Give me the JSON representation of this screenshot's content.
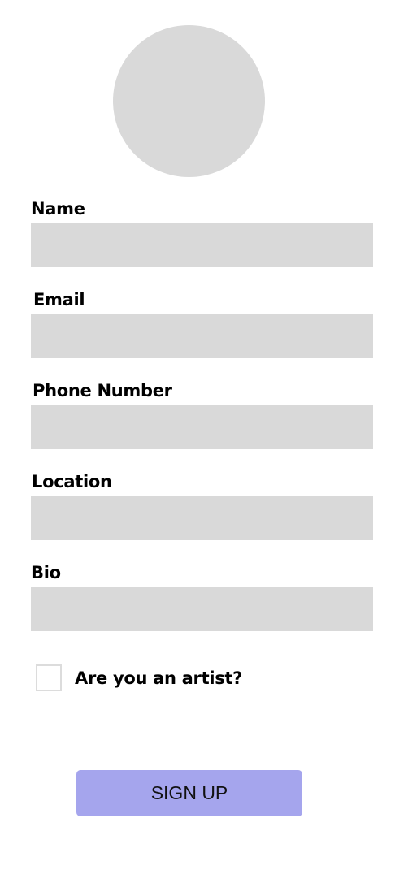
{
  "form": {
    "fields": [
      {
        "label": "Name",
        "value": ""
      },
      {
        "label": "Email",
        "value": ""
      },
      {
        "label": "Phone Number",
        "value": ""
      },
      {
        "label": "Location",
        "value": ""
      },
      {
        "label": "Bio",
        "value": ""
      }
    ],
    "artist_checkbox": {
      "label": "Are you an artist?",
      "checked": false
    },
    "submit_label": "SIGN UP"
  },
  "colors": {
    "field_bg": "#d9d9d9",
    "button_bg": "#a5a5ed"
  }
}
